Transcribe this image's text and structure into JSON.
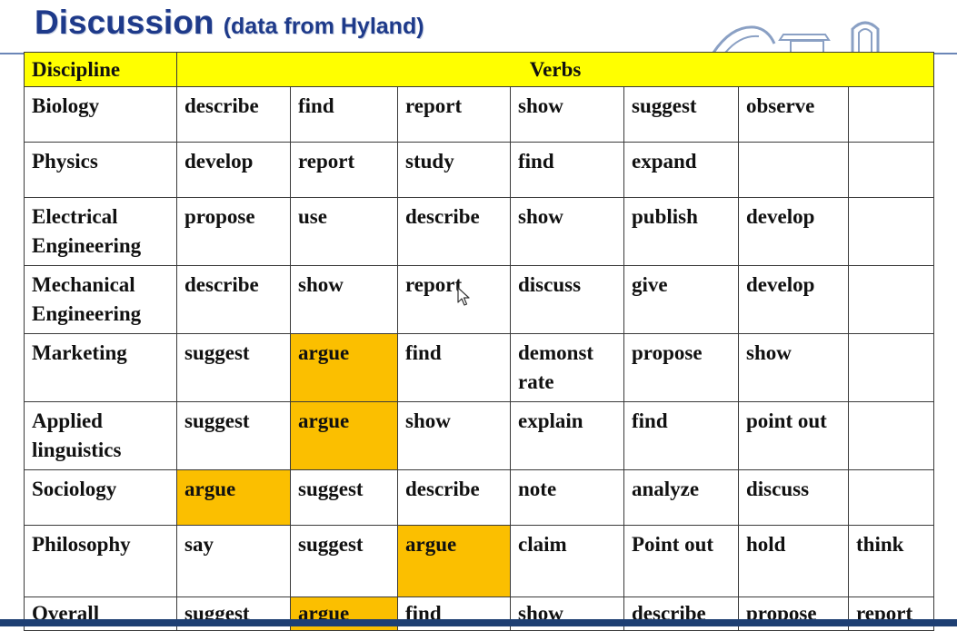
{
  "slide": {
    "title": "Discussion",
    "subtitle": "(data from Hyland)"
  },
  "table": {
    "header": {
      "discipline": "Discipline",
      "verbs": "Verbs"
    },
    "rows": [
      {
        "discipline": "Biology",
        "verbs": [
          "describe",
          "find",
          "report",
          "show",
          "suggest",
          "observe",
          ""
        ]
      },
      {
        "discipline": "Physics",
        "verbs": [
          "develop",
          "report",
          "study",
          "find",
          "expand",
          "",
          ""
        ]
      },
      {
        "discipline": "Electrical Engineering",
        "verbs": [
          "propose",
          "use",
          "describe",
          "show",
          "publish",
          "develop",
          ""
        ]
      },
      {
        "discipline": "Mechanical Engineering",
        "verbs": [
          "describe",
          "show",
          "report",
          "discuss",
          "give",
          "develop",
          ""
        ]
      },
      {
        "discipline": "Marketing",
        "verbs": [
          "suggest",
          "argue",
          "find",
          "demonst rate",
          "propose",
          "show",
          ""
        ]
      },
      {
        "discipline": "Applied linguistics",
        "verbs": [
          "suggest",
          "argue",
          "show",
          "explain",
          "find",
          "point out",
          ""
        ]
      },
      {
        "discipline": "Sociology",
        "verbs": [
          "argue",
          "suggest",
          "describe",
          "note",
          "analyze",
          "discuss",
          ""
        ]
      },
      {
        "discipline": "Philosophy",
        "verbs": [
          "say",
          "suggest",
          "argue",
          "claim",
          "Point out",
          "hold",
          "think"
        ]
      },
      {
        "discipline": "Overall",
        "verbs": [
          "suggest",
          "argue",
          "find",
          "show",
          "describe",
          "propose",
          "report"
        ]
      }
    ]
  },
  "colors": {
    "title": "#1e3a8a",
    "header_fill": "#ffff00",
    "highlight_fill": "#fbbf00",
    "bottom_bar": "#1e3f73"
  },
  "icons": {
    "logo": "university-logo",
    "cursor": "mouse-cursor-icon"
  }
}
